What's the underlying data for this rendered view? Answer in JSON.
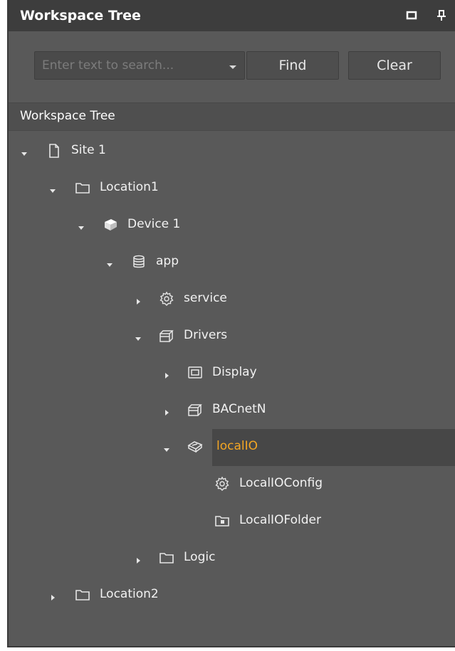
{
  "panel": {
    "title": "Workspace Tree",
    "icons": [
      "maximize-icon",
      "pin-icon"
    ]
  },
  "search": {
    "placeholder": "Enter text to search...",
    "find_label": "Find",
    "clear_label": "Clear"
  },
  "tree_header": "Workspace Tree",
  "tree": {
    "site1": "Site 1",
    "location1": "Location1",
    "device1": "Device 1",
    "app": "app",
    "service": "service",
    "drivers": "Drivers",
    "display": "Display",
    "bacnetn": "BACnetN",
    "localio": "localIO",
    "localioconfig": "LocalIOConfig",
    "localiofolder": "LocalIOFolder",
    "logic": "Logic",
    "location2": "Location2"
  },
  "colors": {
    "panel_bg": "#595959",
    "title_bg": "#3d3d3d",
    "selected_text": "#f4a623",
    "text": "#f2f2f2"
  }
}
